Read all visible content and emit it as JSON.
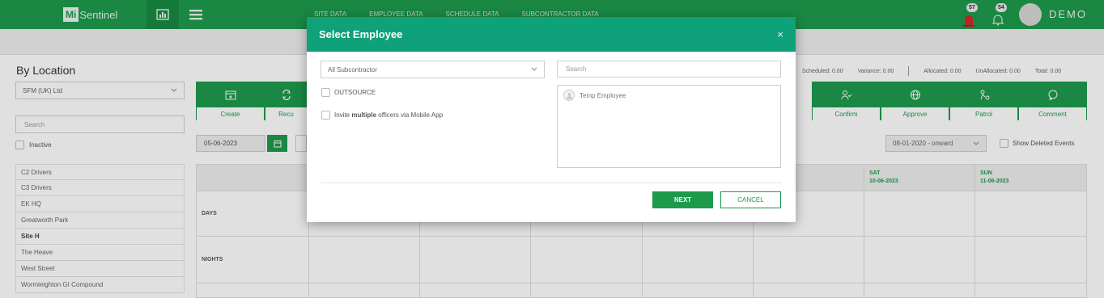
{
  "topbar": {
    "logo_mark": "Mi",
    "logo_text": "Sentinel",
    "nav": [
      "SITE DATA",
      "EMPLOYEE DATA",
      "SCHEDULE DATA",
      "SUBCONTRACTOR DATA"
    ],
    "badge_alerts": "57",
    "badge_notifications": "54",
    "user": "DEMO"
  },
  "left": {
    "heading": "By Location",
    "company_select": "SFM (UK) Ltd",
    "search_placeholder": "Search",
    "inactive_label": "Inactive",
    "locations": [
      "C2 Drivers",
      "C3 Drivers",
      "EK HQ",
      "Greatworth Park",
      "Site H",
      "The Heave",
      "West Street",
      "Wormleighton GI Compound"
    ]
  },
  "actions": {
    "items": [
      "Create",
      "Recu",
      "Confirm",
      "Approve",
      "Patrol",
      "Comment"
    ]
  },
  "toolbar": {
    "date": "05-06-2023",
    "date_range": "08-01-2020 - onward",
    "show_deleted": "Show Deleted Events"
  },
  "stats": {
    "scheduled": "Scheduled: 0.00",
    "variance": "Variance: 0.00",
    "allocated": "Allocated: 0.00",
    "unallocated": "UnAllocated: 0.00",
    "total": "Total: 0.00"
  },
  "schedule": {
    "rows": [
      "DAYS",
      "NIGHTS"
    ],
    "days": [
      {
        "name": "SAT",
        "date": "10-06-2023"
      },
      {
        "name": "SUN",
        "date": "11-06-2023"
      }
    ]
  },
  "modal": {
    "title": "Select Employee",
    "close": "×",
    "subcontractor_select": "All Subcontractor",
    "search_placeholder": "Search",
    "outsource_label": "OUTSOURCE",
    "invite_prefix": "Invite ",
    "invite_bold": "multiple",
    "invite_suffix": " officers via Mobile App",
    "employees": [
      "Temp Employee"
    ],
    "next_label": "NEXT",
    "cancel_label": "CANCEL"
  },
  "colors": {
    "brand_green": "#1e9a4d",
    "modal_header": "#0fa27a"
  }
}
